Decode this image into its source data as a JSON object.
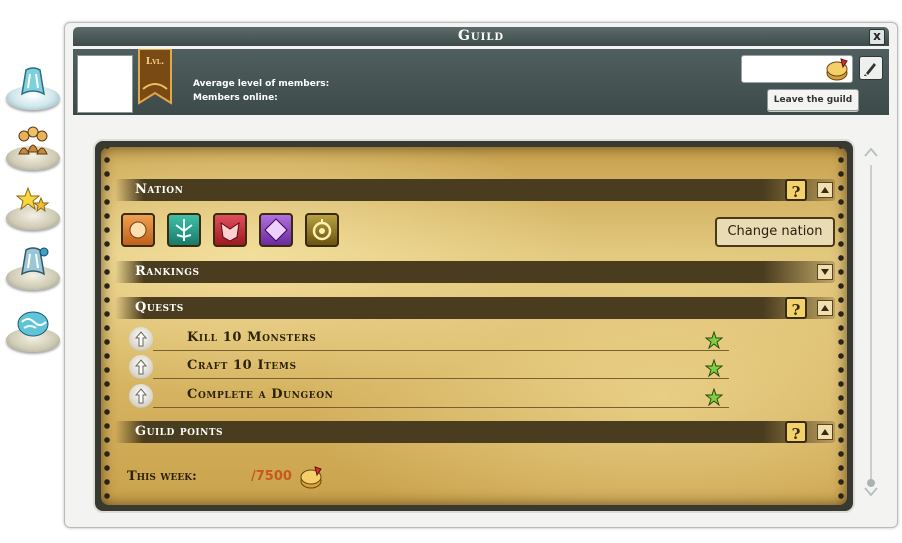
{
  "window": {
    "title": "Guild",
    "close": "x"
  },
  "left_tabs": [
    {
      "name": "guild-tab",
      "icon": "guild-emblem-icon",
      "active": true
    },
    {
      "name": "members-tab",
      "icon": "members-icon",
      "active": false
    },
    {
      "name": "achievements-tab",
      "icon": "stars-icon",
      "active": false
    },
    {
      "name": "emblem-tab",
      "icon": "emblem-icon",
      "active": false
    },
    {
      "name": "map-tab",
      "icon": "world-icon",
      "active": false
    }
  ],
  "header": {
    "level_badge": "Lvl.",
    "avg_level_label": "Average level of members:",
    "members_online_label": "Members online:",
    "search_value": "",
    "leave_button": "Leave the guild"
  },
  "sections": {
    "nation": {
      "title": "Nation",
      "change_button": "Change nation"
    },
    "rankings": {
      "title": "Rankings"
    },
    "quests": {
      "title": "Quests",
      "items": [
        {
          "label": "Kill 10 Monsters"
        },
        {
          "label": "Craft 10 Items"
        },
        {
          "label": "Complete a Dungeon"
        }
      ]
    },
    "guild_points": {
      "title": "Guild points",
      "this_week_label": "This week:",
      "this_week_value": "/7500"
    }
  },
  "nations": [
    {
      "name": "bonta",
      "color": "#e07a2a"
    },
    {
      "name": "brakmar-green",
      "color": "#2aa08a"
    },
    {
      "name": "brakmar",
      "color": "#c8323a"
    },
    {
      "name": "sufokia",
      "color": "#9a4ac4"
    },
    {
      "name": "amakna",
      "color": "#caa43a"
    }
  ],
  "colors": {
    "accent": "#f2d26a",
    "points": "#c7581e",
    "title_bar": "#4e5c5c"
  }
}
